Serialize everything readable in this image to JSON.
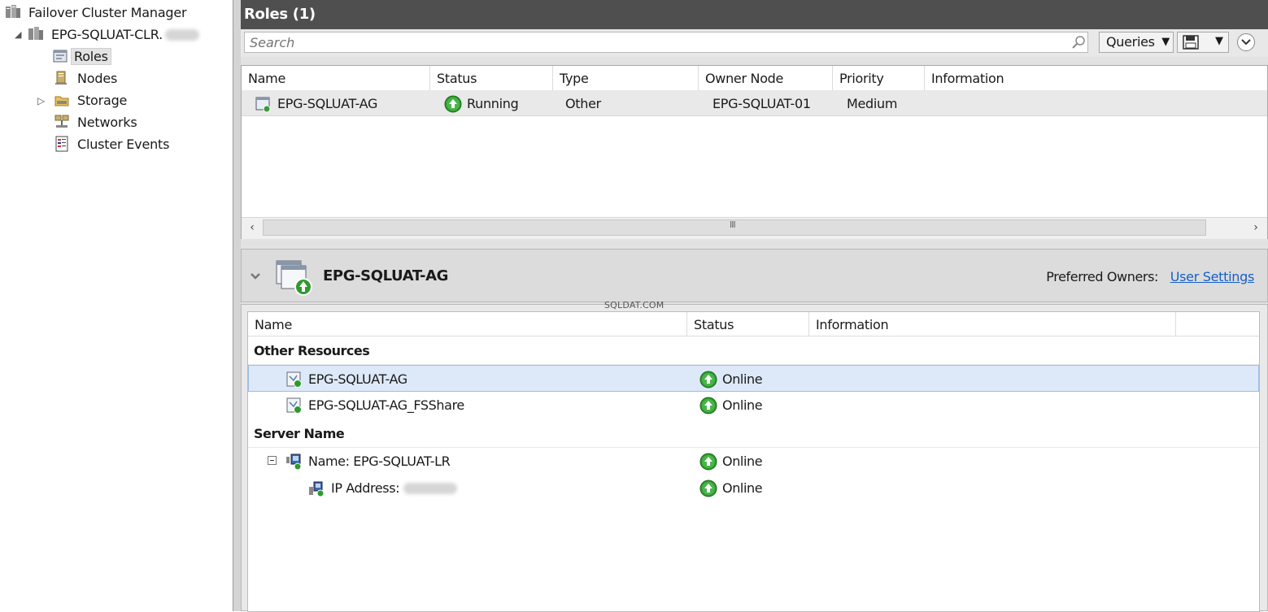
{
  "tree": {
    "root": "Failover Cluster Manager",
    "cluster": "EPG-SQLUAT-CLR.",
    "items": [
      {
        "label": "Roles",
        "selected": true,
        "icon": "roles-icon"
      },
      {
        "label": "Nodes",
        "icon": "nodes-icon"
      },
      {
        "label": "Storage",
        "icon": "storage-icon",
        "expandable": true
      },
      {
        "label": "Networks",
        "icon": "networks-icon"
      },
      {
        "label": "Cluster Events",
        "icon": "cluster-events-icon"
      }
    ]
  },
  "roles": {
    "title": "Roles (1)",
    "search_placeholder": "Search",
    "queries_label": "Queries",
    "columns": [
      "Name",
      "Status",
      "Type",
      "Owner Node",
      "Priority",
      "Information"
    ],
    "rows": [
      {
        "name": "EPG-SQLUAT-AG",
        "status": "Running",
        "type": "Other",
        "owner": "EPG-SQLUAT-01",
        "priority": "Medium",
        "information": ""
      }
    ],
    "scroll_grip": "III"
  },
  "detail": {
    "title": "EPG-SQLUAT-AG",
    "preferred_owners_label": "Preferred Owners:",
    "preferred_owners_link": "User Settings",
    "watermark": "SQLDAT.COM",
    "columns": [
      "Name",
      "Status",
      "Information"
    ],
    "groups": [
      {
        "label": "Other Resources",
        "rows": [
          {
            "name": "EPG-SQLUAT-AG",
            "status": "Online",
            "selected": true
          },
          {
            "name": "EPG-SQLUAT-AG_FSShare",
            "status": "Online"
          }
        ]
      },
      {
        "label": "Server Name",
        "rows": [
          {
            "name": "Name: EPG-SQLUAT-LR",
            "status": "Online"
          },
          {
            "name": "IP Address:",
            "status": "Online"
          }
        ]
      }
    ]
  },
  "colors": {
    "header_bg": "#4f4f4f",
    "status_green": "#2e9a2e",
    "link_blue": "#1560c8",
    "selected_row": "#dde9f8"
  }
}
